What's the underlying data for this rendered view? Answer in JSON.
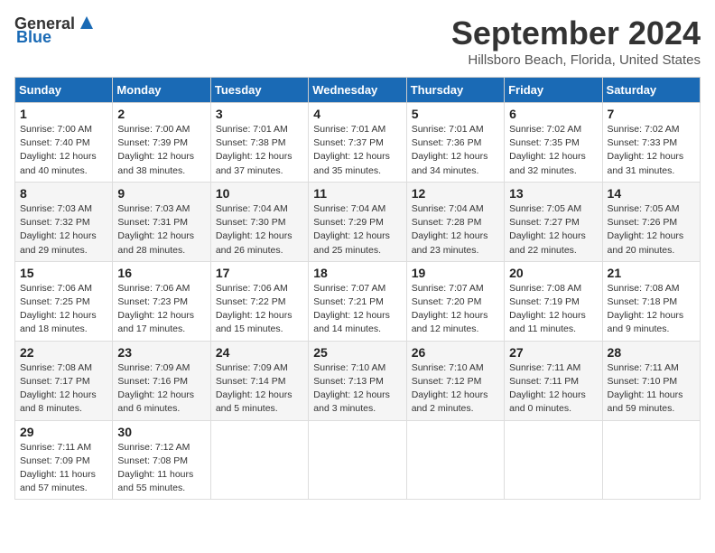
{
  "header": {
    "logo_general": "General",
    "logo_blue": "Blue",
    "month": "September 2024",
    "location": "Hillsboro Beach, Florida, United States"
  },
  "days_of_week": [
    "Sunday",
    "Monday",
    "Tuesday",
    "Wednesday",
    "Thursday",
    "Friday",
    "Saturday"
  ],
  "weeks": [
    [
      {
        "day": "1",
        "sunrise": "7:00 AM",
        "sunset": "7:40 PM",
        "daylight": "12 hours and 40 minutes."
      },
      {
        "day": "2",
        "sunrise": "7:00 AM",
        "sunset": "7:39 PM",
        "daylight": "12 hours and 38 minutes."
      },
      {
        "day": "3",
        "sunrise": "7:01 AM",
        "sunset": "7:38 PM",
        "daylight": "12 hours and 37 minutes."
      },
      {
        "day": "4",
        "sunrise": "7:01 AM",
        "sunset": "7:37 PM",
        "daylight": "12 hours and 35 minutes."
      },
      {
        "day": "5",
        "sunrise": "7:01 AM",
        "sunset": "7:36 PM",
        "daylight": "12 hours and 34 minutes."
      },
      {
        "day": "6",
        "sunrise": "7:02 AM",
        "sunset": "7:35 PM",
        "daylight": "12 hours and 32 minutes."
      },
      {
        "day": "7",
        "sunrise": "7:02 AM",
        "sunset": "7:33 PM",
        "daylight": "12 hours and 31 minutes."
      }
    ],
    [
      {
        "day": "8",
        "sunrise": "7:03 AM",
        "sunset": "7:32 PM",
        "daylight": "12 hours and 29 minutes."
      },
      {
        "day": "9",
        "sunrise": "7:03 AM",
        "sunset": "7:31 PM",
        "daylight": "12 hours and 28 minutes."
      },
      {
        "day": "10",
        "sunrise": "7:04 AM",
        "sunset": "7:30 PM",
        "daylight": "12 hours and 26 minutes."
      },
      {
        "day": "11",
        "sunrise": "7:04 AM",
        "sunset": "7:29 PM",
        "daylight": "12 hours and 25 minutes."
      },
      {
        "day": "12",
        "sunrise": "7:04 AM",
        "sunset": "7:28 PM",
        "daylight": "12 hours and 23 minutes."
      },
      {
        "day": "13",
        "sunrise": "7:05 AM",
        "sunset": "7:27 PM",
        "daylight": "12 hours and 22 minutes."
      },
      {
        "day": "14",
        "sunrise": "7:05 AM",
        "sunset": "7:26 PM",
        "daylight": "12 hours and 20 minutes."
      }
    ],
    [
      {
        "day": "15",
        "sunrise": "7:06 AM",
        "sunset": "7:25 PM",
        "daylight": "12 hours and 18 minutes."
      },
      {
        "day": "16",
        "sunrise": "7:06 AM",
        "sunset": "7:23 PM",
        "daylight": "12 hours and 17 minutes."
      },
      {
        "day": "17",
        "sunrise": "7:06 AM",
        "sunset": "7:22 PM",
        "daylight": "12 hours and 15 minutes."
      },
      {
        "day": "18",
        "sunrise": "7:07 AM",
        "sunset": "7:21 PM",
        "daylight": "12 hours and 14 minutes."
      },
      {
        "day": "19",
        "sunrise": "7:07 AM",
        "sunset": "7:20 PM",
        "daylight": "12 hours and 12 minutes."
      },
      {
        "day": "20",
        "sunrise": "7:08 AM",
        "sunset": "7:19 PM",
        "daylight": "12 hours and 11 minutes."
      },
      {
        "day": "21",
        "sunrise": "7:08 AM",
        "sunset": "7:18 PM",
        "daylight": "12 hours and 9 minutes."
      }
    ],
    [
      {
        "day": "22",
        "sunrise": "7:08 AM",
        "sunset": "7:17 PM",
        "daylight": "12 hours and 8 minutes."
      },
      {
        "day": "23",
        "sunrise": "7:09 AM",
        "sunset": "7:16 PM",
        "daylight": "12 hours and 6 minutes."
      },
      {
        "day": "24",
        "sunrise": "7:09 AM",
        "sunset": "7:14 PM",
        "daylight": "12 hours and 5 minutes."
      },
      {
        "day": "25",
        "sunrise": "7:10 AM",
        "sunset": "7:13 PM",
        "daylight": "12 hours and 3 minutes."
      },
      {
        "day": "26",
        "sunrise": "7:10 AM",
        "sunset": "7:12 PM",
        "daylight": "12 hours and 2 minutes."
      },
      {
        "day": "27",
        "sunrise": "7:11 AM",
        "sunset": "7:11 PM",
        "daylight": "12 hours and 0 minutes."
      },
      {
        "day": "28",
        "sunrise": "7:11 AM",
        "sunset": "7:10 PM",
        "daylight": "11 hours and 59 minutes."
      }
    ],
    [
      {
        "day": "29",
        "sunrise": "7:11 AM",
        "sunset": "7:09 PM",
        "daylight": "11 hours and 57 minutes."
      },
      {
        "day": "30",
        "sunrise": "7:12 AM",
        "sunset": "7:08 PM",
        "daylight": "11 hours and 55 minutes."
      },
      null,
      null,
      null,
      null,
      null
    ]
  ]
}
